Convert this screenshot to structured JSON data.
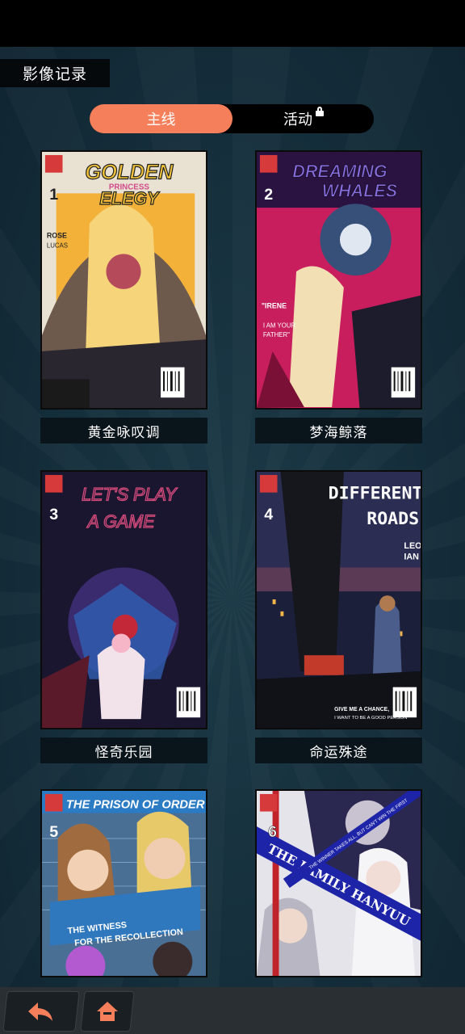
{
  "page": {
    "title": "影像记录"
  },
  "tabs": [
    {
      "label": "主线",
      "active": true
    },
    {
      "label": "活动",
      "active": false,
      "locked": true
    }
  ],
  "comics": [
    {
      "number": "1",
      "title": "黄金咏叹调",
      "cover_title": "GOLDEN ELEGY",
      "cover_subtitle": "PRINCESS",
      "cover_names": "ROSE LUCAS",
      "accent": "#f3b13a"
    },
    {
      "number": "2",
      "title": "梦海鲸落",
      "cover_title": "DREAMING WHALES",
      "cover_subtitle": "",
      "cover_names": "\"IRENE I AM YOUR FATHER\"",
      "accent": "#d6246b"
    },
    {
      "number": "3",
      "title": "怪奇乐园",
      "cover_title": "LET'S PLAY A GAME",
      "cover_subtitle": "",
      "cover_names": "",
      "accent": "#c23a6e"
    },
    {
      "number": "4",
      "title": "命运殊途",
      "cover_title": "DIFFERENT ROADS",
      "cover_subtitle": "GIVE ME A CHANCE, I WANT TO BE A GOOD PERSON",
      "cover_names": "LEO IAN",
      "accent": "#e98a3a"
    },
    {
      "number": "5",
      "title": "",
      "cover_title": "THE PRISON OF ORDER",
      "cover_subtitle": "THE WITNESS FOR THE RECOLLECTION",
      "cover_names": "",
      "accent": "#3f8fc9"
    },
    {
      "number": "6",
      "title": "",
      "cover_title": "THE FAMILY HANYUU",
      "cover_subtitle": "THE WINNER TAKES ALL, BUT CAN'T WIN THE FIRST",
      "cover_names": "",
      "accent": "#2c2fae"
    }
  ],
  "nav": {
    "back_icon": "back-arrow-icon",
    "home_icon": "home-icon"
  },
  "colors": {
    "accent": "#f57f5b",
    "background": "#16303d"
  }
}
